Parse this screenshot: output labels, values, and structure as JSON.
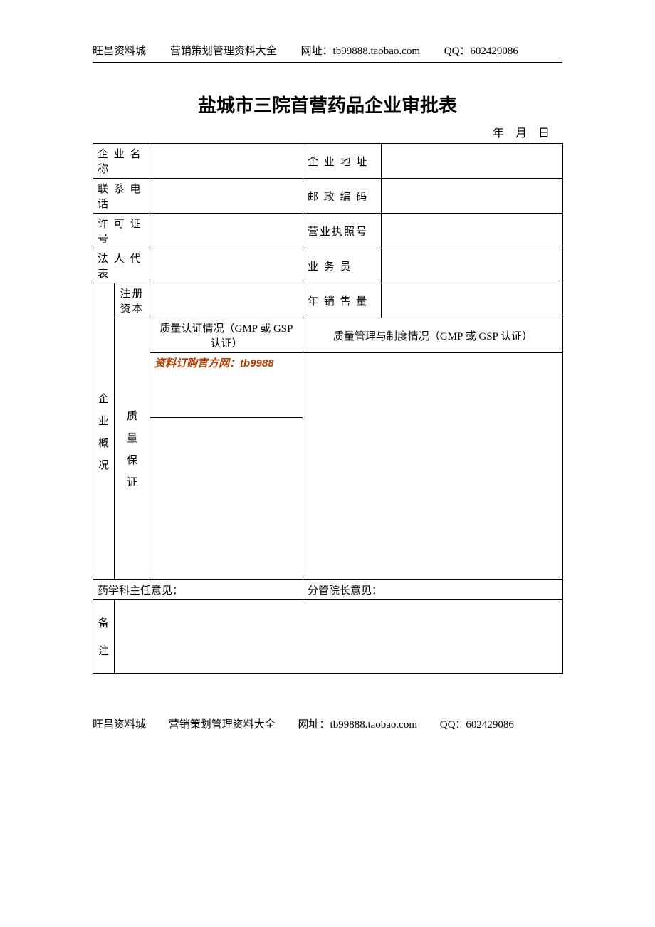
{
  "header": {
    "site": "旺昌资料城",
    "category": "营销策划管理资料大全",
    "url_label": "网址：tb99888.taobao.com",
    "qq_label": "QQ：602429086"
  },
  "title": "盐城市三院首营药品企业审批表",
  "date": {
    "year": "年",
    "month": "月",
    "day": "日"
  },
  "labels": {
    "company_name": "企 业 名 称",
    "company_addr": "企 业 地 址",
    "phone": "联 系 电 话",
    "postal": "邮 政 编 码",
    "license": "许 可 证 号",
    "bizlicense": "营业执照号",
    "legal_rep": "法 人 代 表",
    "salesman": "业   务   员",
    "reg_capital": "注册资本",
    "annual_sales": "年 销 售 量",
    "overview": "企业概况",
    "qa": {
      "c1": "质",
      "c2": "量",
      "c3": "保",
      "c4": "证"
    },
    "cert_status": "质量认证情况（GMP 或 GSP 认证）",
    "mgmt_status": "质量管理与制度情况（GMP 或 GSP 认证）",
    "watermark": "资料订购官方网：tb9988",
    "pharmacy_opinion": "药学科主任意见：",
    "director_opinion": "分管院长意见：",
    "remarks": {
      "c1": "备",
      "c2": "注"
    }
  },
  "values": {
    "company_name": "",
    "company_addr": "",
    "phone": "",
    "postal": "",
    "license": "",
    "bizlicense": "",
    "legal_rep": "",
    "salesman": "",
    "reg_capital": "",
    "annual_sales": "",
    "cert_status": "",
    "mgmt_status": "",
    "pharmacy_opinion": "",
    "director_opinion": "",
    "remarks": ""
  },
  "footer": {
    "site": "旺昌资料城",
    "category": "营销策划管理资料大全",
    "url_label": "网址：tb99888.taobao.com",
    "qq_label": "QQ：602429086"
  }
}
